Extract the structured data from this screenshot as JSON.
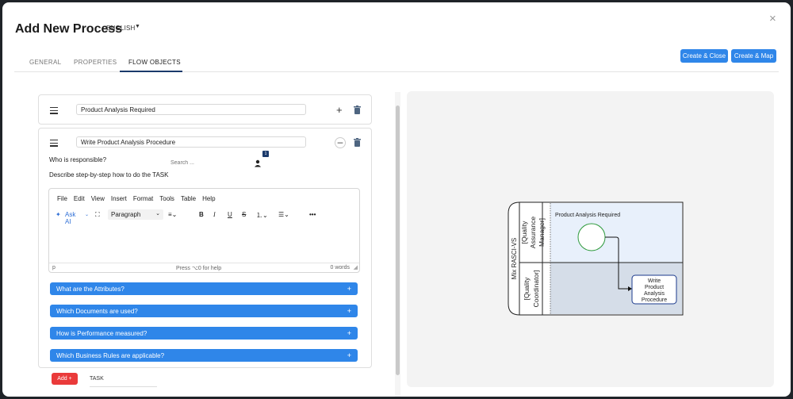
{
  "header": {
    "title": "Add New Process",
    "language": "ENGLISH",
    "close": "×"
  },
  "tabs": [
    {
      "label": "GENERAL",
      "active": false
    },
    {
      "label": "PROPERTIES",
      "active": false
    },
    {
      "label": "FLOW OBJECTS",
      "active": true
    }
  ],
  "buttons": {
    "create_close": "Create & Close",
    "create_map": "Create & Map"
  },
  "flow_objects": [
    {
      "title": "Product Analysis Required",
      "expanded": false
    },
    {
      "title": "Write Product Analysis Procedure",
      "expanded": true
    }
  ],
  "task_detail": {
    "responsible_label": "Who is responsible?",
    "search_placeholder": "Search ...",
    "assignee_count": "1",
    "describe_label": "Describe step-by-step how to do the TASK"
  },
  "editor": {
    "menu": [
      "File",
      "Edit",
      "View",
      "Insert",
      "Format",
      "Tools",
      "Table",
      "Help"
    ],
    "ask_ai": "Ask AI",
    "paragraph": "Paragraph",
    "status_left": "p",
    "status_center": "Press ⌥0 for help",
    "status_right": "0 words"
  },
  "accordions": [
    {
      "label": "What are the Attributes?"
    },
    {
      "label": "Which Documents are used?"
    },
    {
      "label": "How is Performance measured?"
    },
    {
      "label": "Which Business Rules are applicable?"
    }
  ],
  "add": {
    "button": "Add +",
    "type": "TASK"
  },
  "diagram": {
    "pool_label": "Mix RASCI-VS",
    "lanes": [
      {
        "line1": "[Quality",
        "line2": "Assurance",
        "line3": "Manager]"
      },
      {
        "line1": "[Quality",
        "line2": "Coordinator]"
      }
    ],
    "start_label": "Product Analysis Required",
    "task_lines": [
      "Write",
      "Product",
      "Analysis",
      "Procedure"
    ],
    "colors": {
      "lane1": "#e8f0fb",
      "lane2": "#d5dde8",
      "start_stroke": "#2e9a3c",
      "task_stroke": "#1b3a8c"
    }
  }
}
